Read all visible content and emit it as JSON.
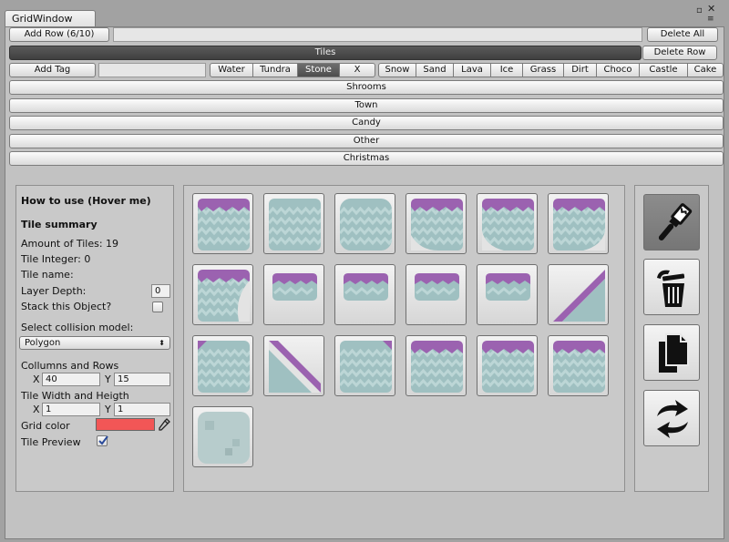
{
  "window": {
    "tab_title": "GridWindow"
  },
  "toolbar": {
    "add_row": "Add Row (6/10)",
    "delete_all": "Delete All",
    "tiles_header": "Tiles",
    "delete_row": "Delete Row",
    "add_tag": "Add Tag"
  },
  "tags": [
    "Water",
    "Tundra",
    "Stone",
    "X",
    "Snow",
    "Sand",
    "Lava",
    "Ice",
    "Grass",
    "Dirt",
    "Choco",
    "Castle",
    "Cake"
  ],
  "active_tag": "Stone",
  "categories": [
    "Shrooms",
    "Town",
    "Candy",
    "Other",
    "Christmas"
  ],
  "sidebar": {
    "how_to": "How to use (Hover me)",
    "summary_title": "Tile summary",
    "amount": "Amount of Tiles: 19",
    "integer": "Tile Integer: 0",
    "name": "Tile name:",
    "layer_depth_label": "Layer Depth:",
    "layer_depth_value": "0",
    "stack_label": "Stack this Object?",
    "stack_checked": false,
    "collision_label": "Select collision model:",
    "collision_value": "Polygon",
    "cols_rows_label": "Collumns and Rows",
    "x_label": "X",
    "y_label": "Y",
    "cols_value": "40",
    "rows_value": "15",
    "wh_label": "Tile Width and Heigth",
    "width_value": "1",
    "height_value": "1",
    "grid_color_label": "Grid color",
    "grid_color": "#f25656",
    "preview_label": "Tile Preview",
    "preview_checked": true
  },
  "tile_types": [
    "top",
    "plain",
    "rounded",
    "top-corner-left",
    "top-curl-left",
    "top-curl-right",
    "top-curl-bottom-right",
    "top-small",
    "top-small",
    "top-small",
    "top-small",
    "diag-up",
    "corner-left",
    "diag-down",
    "corner-right",
    "top",
    "top",
    "top",
    "preview"
  ],
  "tools": [
    {
      "name": "paint-brush-icon",
      "selected": true
    },
    {
      "name": "trash-icon",
      "selected": false
    },
    {
      "name": "copy-icon",
      "selected": false
    },
    {
      "name": "refresh-icon",
      "selected": false
    }
  ],
  "colors": {
    "tile_teal": "#9fc0c1",
    "tile_purple": "#9b62b0",
    "zigzag_light": "#bcd6d6"
  }
}
